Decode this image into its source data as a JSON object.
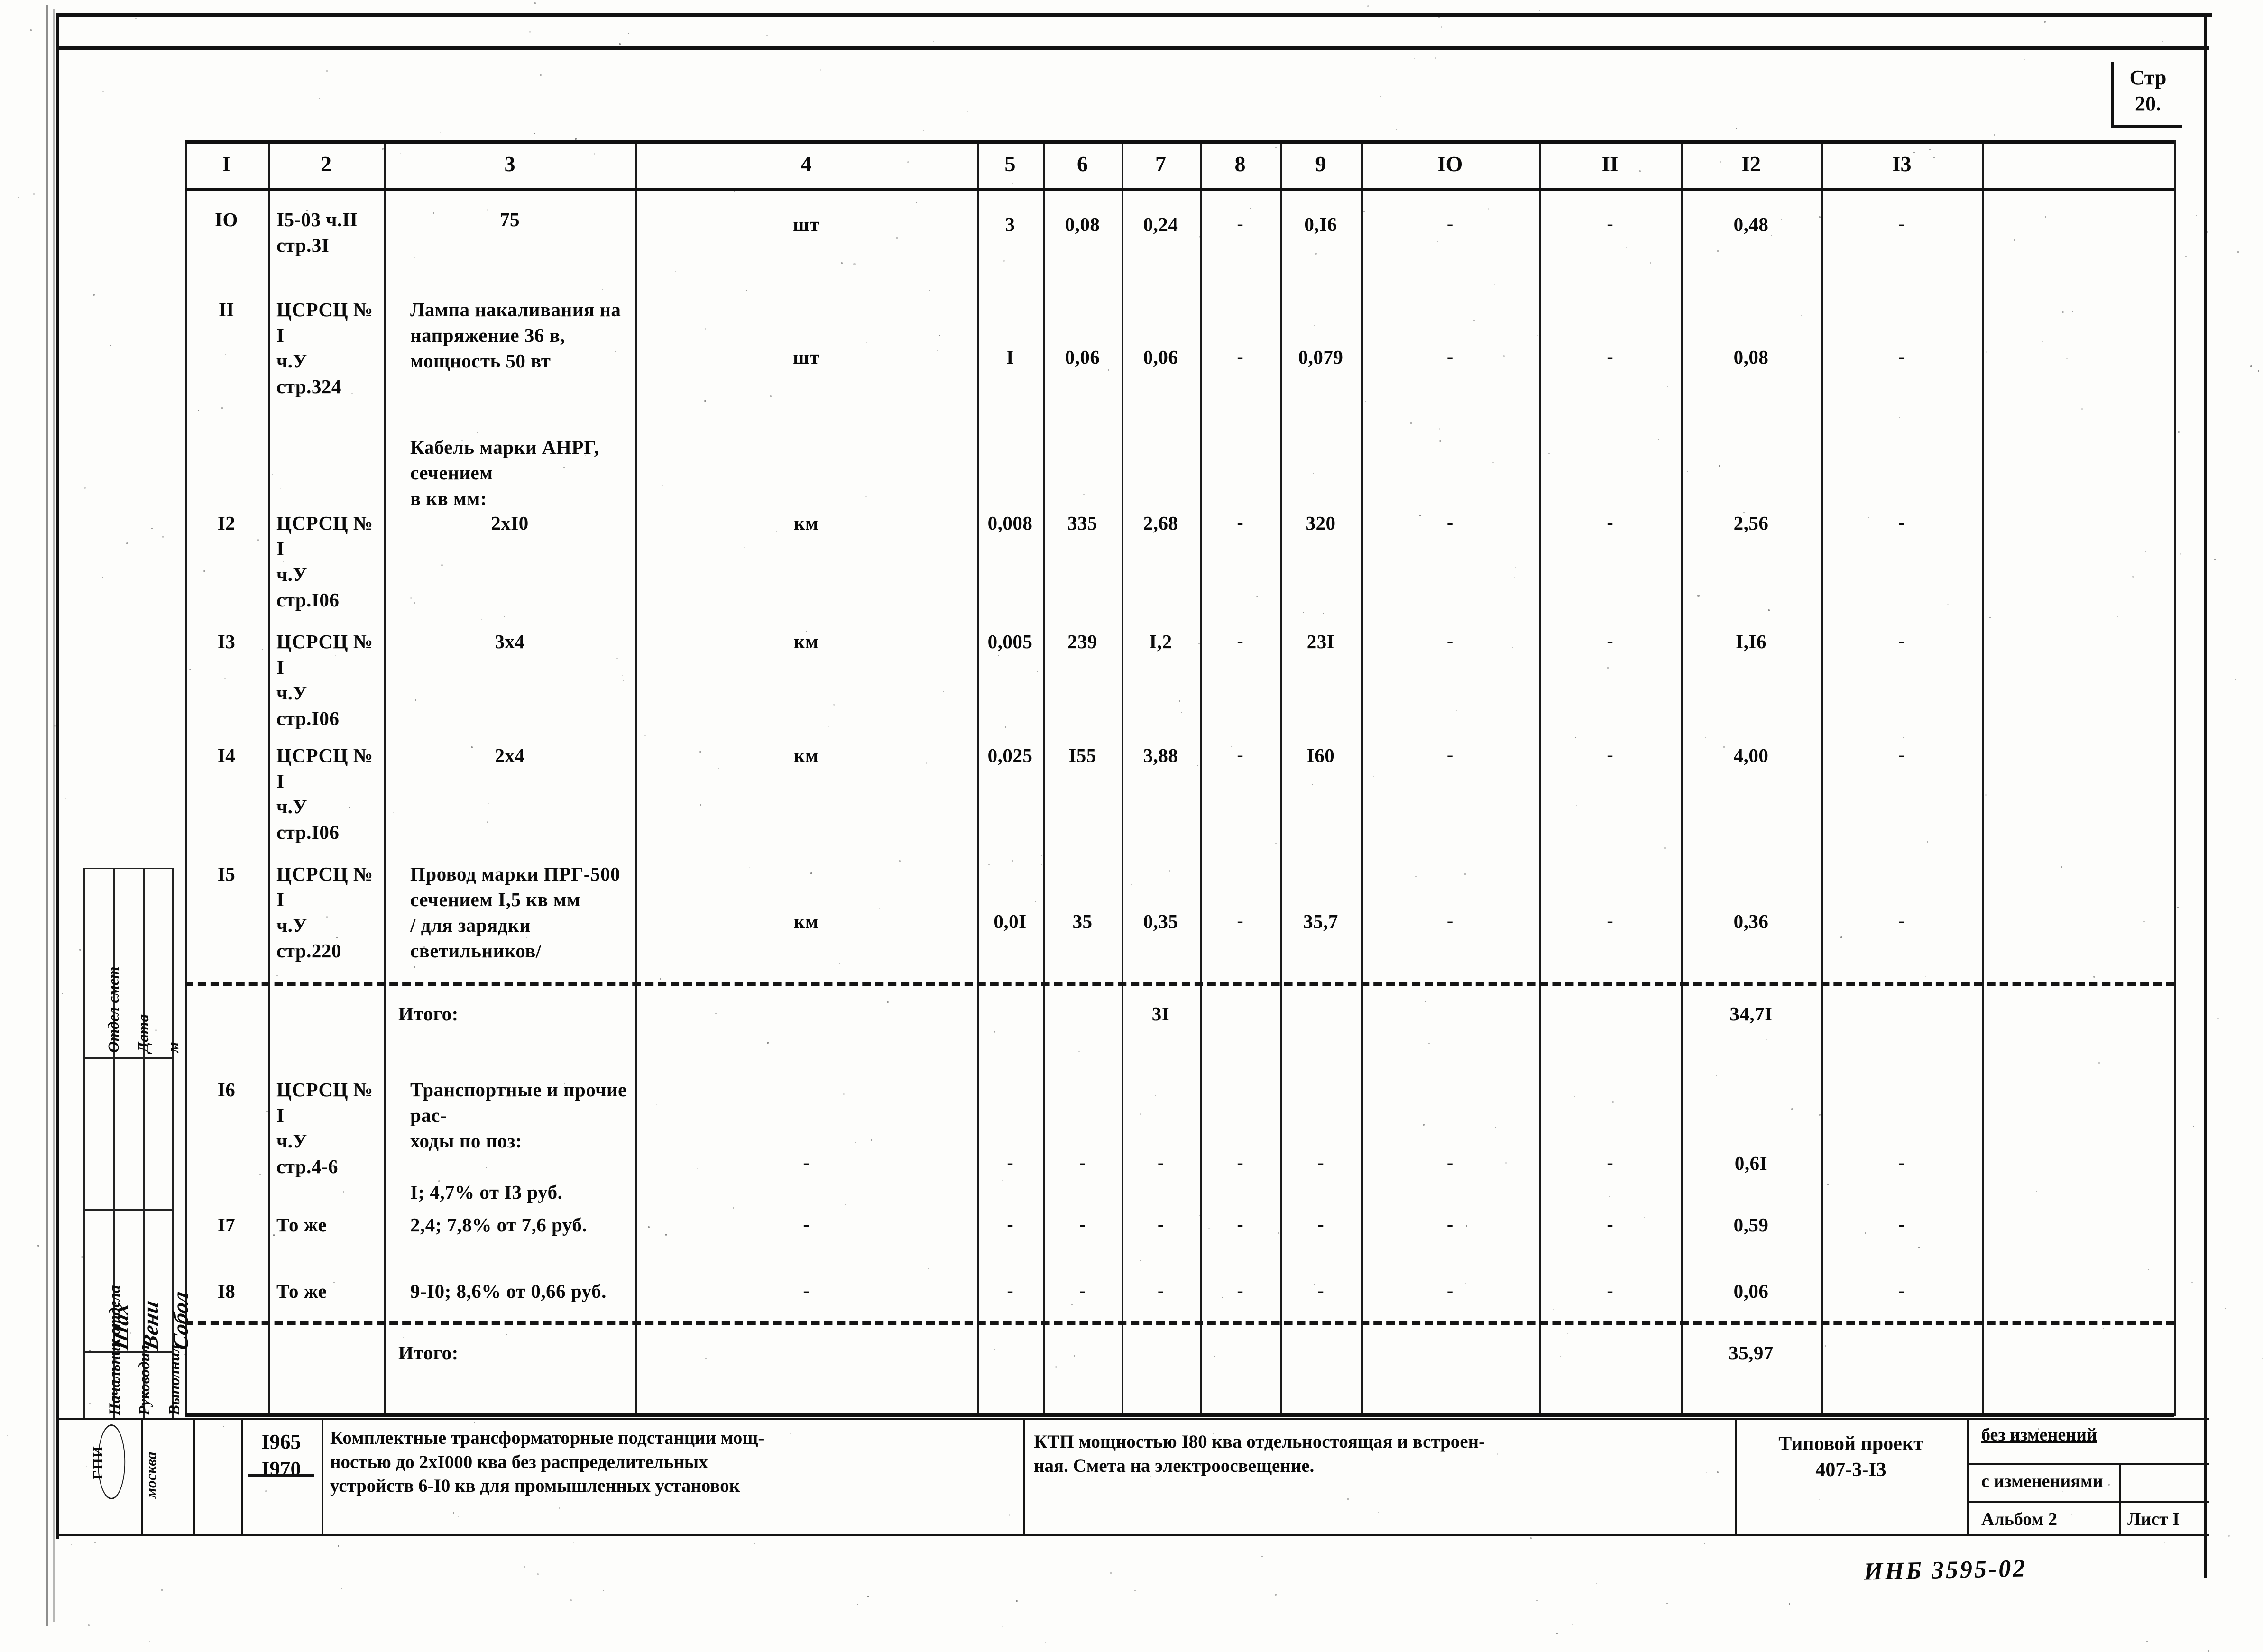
{
  "page": {
    "label": "Стр",
    "number": "20."
  },
  "table": {
    "headers": [
      "I",
      "2",
      "3",
      "4",
      "5",
      "6",
      "7",
      "8",
      "9",
      "IO",
      "II",
      "I2",
      "I3"
    ],
    "rows": [
      {
        "pos": "IO",
        "source": [
          "I5-03 ч.II",
          "стр.3I"
        ],
        "desc": [
          "75"
        ],
        "desc_align": "center",
        "unit": "шт",
        "qty": "3",
        "c6": "0,08",
        "c7": "0,24",
        "c8": "-",
        "c9": "0,I6",
        "c10": "-",
        "c11": "-",
        "c12": "0,48",
        "c13": "-"
      },
      {
        "pos": "II",
        "source": [
          "ЦСРСЦ № I",
          "ч.У",
          "стр.324"
        ],
        "desc": [
          "Лампа накаливания на",
          "напряжение 36 в,",
          "мощность 50 вт"
        ],
        "desc_align": "left",
        "unit": "шт",
        "qty": "I",
        "c6": "0,06",
        "c7": "0,06",
        "c8": "-",
        "c9": "0,079",
        "c10": "-",
        "c11": "-",
        "c12": "0,08",
        "c13": "-"
      },
      {
        "pos": "",
        "source": [],
        "desc": [
          "Кабель марки АНРГ, сечением",
          "в кв мм:"
        ],
        "desc_align": "left",
        "unit": "",
        "qty": "",
        "c6": "",
        "c7": "",
        "c8": "",
        "c9": "",
        "c10": "",
        "c11": "",
        "c12": "",
        "c13": ""
      },
      {
        "pos": "I2",
        "source": [
          "ЦСРСЦ № I",
          "ч.У",
          "стр.I06"
        ],
        "desc": [
          "2xI0"
        ],
        "desc_align": "center",
        "unit": "км",
        "qty": "0,008",
        "c6": "335",
        "c7": "2,68",
        "c8": "-",
        "c9": "320",
        "c10": "-",
        "c11": "-",
        "c12": "2,56",
        "c13": "-"
      },
      {
        "pos": "I3",
        "source": [
          "ЦСРСЦ № I",
          "ч.У",
          "стр.I06"
        ],
        "desc": [
          "3x4"
        ],
        "desc_align": "center",
        "unit": "км",
        "qty": "0,005",
        "c6": "239",
        "c7": "I,2",
        "c8": "-",
        "c9": "23I",
        "c10": "-",
        "c11": "-",
        "c12": "I,I6",
        "c13": "-"
      },
      {
        "pos": "I4",
        "source": [
          "ЦСРСЦ № I",
          "ч.У",
          "стр.I06"
        ],
        "desc": [
          "2x4"
        ],
        "desc_align": "center",
        "unit": "км",
        "qty": "0,025",
        "c6": "I55",
        "c7": "3,88",
        "c8": "-",
        "c9": "I60",
        "c10": "-",
        "c11": "-",
        "c12": "4,00",
        "c13": "-"
      },
      {
        "pos": "I5",
        "source": [
          "ЦСРСЦ № I",
          "ч.У",
          "стр.220"
        ],
        "desc": [
          "Провод марки ПРГ-500",
          "сечением I,5 кв мм",
          "/ для зарядки светильников/"
        ],
        "desc_align": "left",
        "unit": "км",
        "qty": "0,0I",
        "c6": "35",
        "c7": "0,35",
        "c8": "-",
        "c9": "35,7",
        "c10": "-",
        "c11": "-",
        "c12": "0,36",
        "c13": "-"
      }
    ],
    "subtotal": {
      "label": "Итого:",
      "c7": "3I",
      "c12": "34,7I"
    },
    "extra_rows": [
      {
        "pos": "I6",
        "source": [
          "ЦСРСЦ № I",
          "ч.У",
          "стр.4-6"
        ],
        "desc": [
          "Транспортные и прочие рас-",
          "ходы по поз:",
          "",
          "I; 4,7% от I3 руб."
        ],
        "desc_align": "left",
        "unit": "-",
        "qty": "-",
        "c6": "-",
        "c7": "-",
        "c8": "-",
        "c9": "-",
        "c10": "-",
        "c11": "-",
        "c12": "0,6I",
        "c13": "-"
      },
      {
        "pos": "I7",
        "source": [
          "То же"
        ],
        "desc": [
          "2,4; 7,8% от 7,6 руб."
        ],
        "desc_align": "left",
        "unit": "-",
        "qty": "-",
        "c6": "-",
        "c7": "-",
        "c8": "-",
        "c9": "-",
        "c10": "-",
        "c11": "-",
        "c12": "0,59",
        "c13": "-"
      },
      {
        "pos": "I8",
        "source": [
          "То же"
        ],
        "desc": [
          "9-I0; 8,6% от 0,66 руб."
        ],
        "desc_align": "left",
        "unit": "-",
        "qty": "-",
        "c6": "-",
        "c7": "-",
        "c8": "-",
        "c9": "-",
        "c10": "-",
        "c11": "-",
        "c12": "0,06",
        "c13": "-"
      }
    ],
    "total": {
      "label": "Итого:",
      "c12": "35,97"
    }
  },
  "stamp": {
    "col_headers": [
      "Отдел смет",
      "Дата",
      "м"
    ],
    "role_labels": [
      "Начальник отдела",
      "Руководил",
      "Выполнил"
    ],
    "signatures": [
      "Шах",
      "Вени",
      "Собол"
    ]
  },
  "title_block": {
    "logo_text": "ГПИ",
    "city": "москва",
    "years": [
      "I965",
      "I970"
    ],
    "org_desc": [
      "Комплектные трансформаторные подстанции мощ-",
      "ностью до 2xI000 ква без распределительных",
      "устройств 6-I0 кв для промышленных установок"
    ],
    "sheet_desc": [
      "КТП мощностью I80 ква отдельностоящая и встроен-",
      "ная. Смета на электроосвещение."
    ],
    "project_label": "Типовой проект",
    "project_number": "407-3-I3",
    "revision_no": "без изменений",
    "revision_with": "с изменениями",
    "album_label": "Альбом 2",
    "sheet_label": "Лист",
    "sheet_number": "I"
  },
  "hand_note": "ИНБ   3595-02"
}
